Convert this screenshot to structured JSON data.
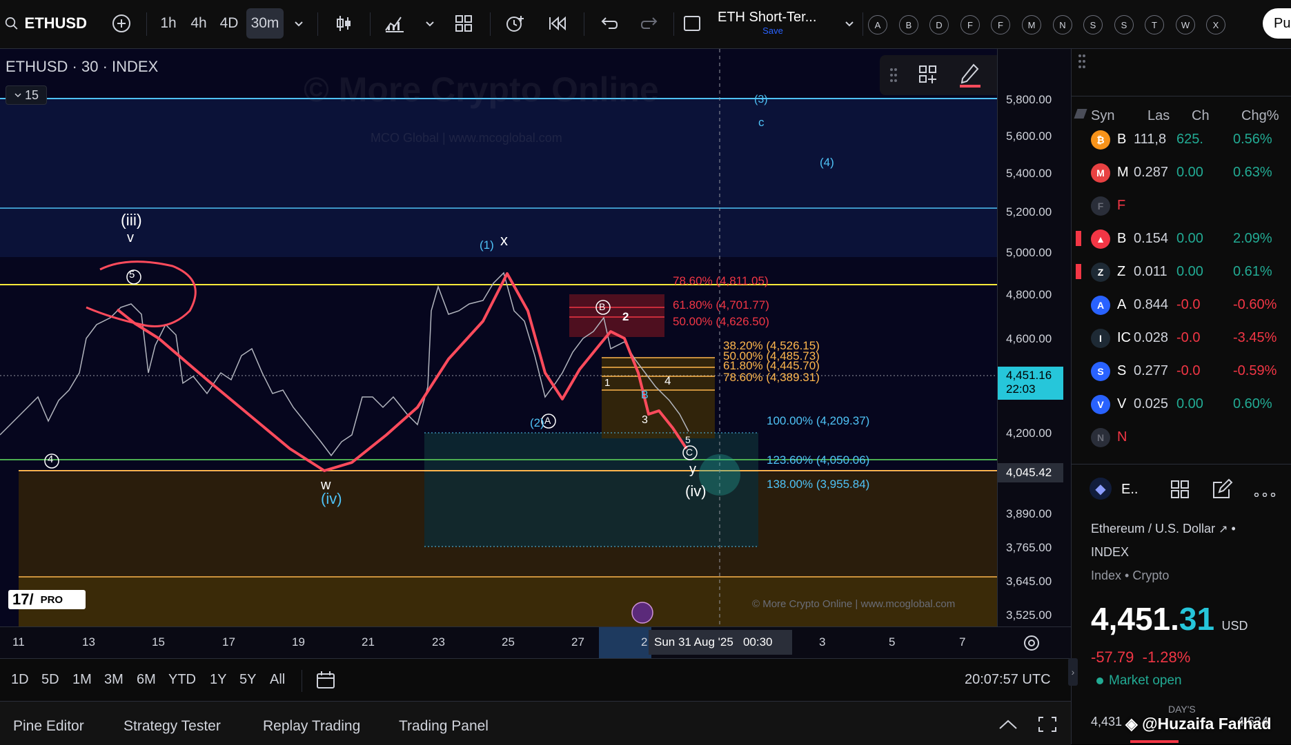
{
  "toolbar": {
    "symbol": "ETHUSD",
    "timeframes": [
      "1h",
      "4h",
      "4D",
      "30m"
    ],
    "layout_title": "ETH Short-Ter...",
    "layout_sub": "Save",
    "alert_letters": [
      "A",
      "B",
      "D",
      "F",
      "F",
      "M",
      "N",
      "S",
      "S",
      "T",
      "W",
      "X"
    ],
    "publish_partial": "Pu"
  },
  "chart": {
    "legend_title": "ETHUSD · 30 · INDEX",
    "indicator_count": "15",
    "watermark_main": "© More Crypto Online",
    "watermark_sub": "MCO Global  |  www.mcoglobal.com",
    "footer_watermark": "© More Crypto Online  |  www.mcoglobal.com",
    "logo_text": "PRO",
    "wave_labels": {
      "iii": "(iii)",
      "v_small": "v",
      "five": "5",
      "four_small": "4",
      "w": "w",
      "iv_left": "(iv)",
      "one": "(1)",
      "x": "x",
      "two": "(2)",
      "A": "A",
      "B_circ": "B",
      "two_num": "2",
      "one_num": "1",
      "four_num": "4",
      "B": "B",
      "three": "3",
      "five_small": "5",
      "C_circ": "C",
      "y": "y",
      "iv_right": "(iv)",
      "three_top": "(3)",
      "c_top": "c",
      "four_top": "(4)"
    },
    "fib_levels": [
      "78.60% (4,811.05)",
      "61.80% (4,701.77)",
      "50.00% (4,626.50)",
      "38.20% (4,526.15)",
      "50.00% (4,485.73)",
      "61.80% (4,445.70)",
      "78.60% (4,389.31)",
      "100.00% (4,209.37)",
      "123.60% (4,050.06)",
      "138.00% (3,955.84)"
    ],
    "stroke_width_label": "3px"
  },
  "price_axis": {
    "labels": [
      "5,800.00",
      "5,600.00",
      "5,400.00",
      "5,200.00",
      "5,000.00",
      "4,800.00",
      "4,600.00",
      "4,200.00",
      "3,890.00",
      "3,765.00",
      "3,645.00",
      "3,525.00"
    ],
    "current_price": "4,451.16",
    "countdown": "22:03",
    "crosshair_price": "4,045.42"
  },
  "time_axis": {
    "labels": [
      "11",
      "13",
      "15",
      "17",
      "19",
      "21",
      "23",
      "25",
      "27",
      "2",
      "3",
      "5",
      "7"
    ],
    "crosshair_time": "Sun 31 Aug '25   00:30"
  },
  "range_bar": {
    "ranges": [
      "1D",
      "5D",
      "1M",
      "3M",
      "6M",
      "YTD",
      "1Y",
      "5Y",
      "All"
    ],
    "clock": "20:07:57 UTC"
  },
  "bottom_panel": {
    "tabs": [
      "Pine Editor",
      "Strategy Tester",
      "Replay Trading",
      "Trading Panel"
    ]
  },
  "watchlist": {
    "headers": [
      "Syn",
      "Las",
      "Ch",
      "Chg%"
    ],
    "rows": [
      {
        "sym": "B",
        "last": "111,8",
        "ch": "625.",
        "chg": "0.56%",
        "color": "#f7931a",
        "glyph": "₿",
        "ch_dir": "pos",
        "chg_dir": "pos",
        "flag": false
      },
      {
        "sym": "M",
        "last": "0.287",
        "ch": "0.00",
        "chg": "0.63%",
        "color": "#e84142",
        "glyph": "M",
        "ch_dir": "pos",
        "chg_dir": "pos",
        "flag": false
      },
      {
        "sym": "F",
        "last": "",
        "ch": "",
        "chg": "",
        "color": "#2a2e39",
        "glyph": "F",
        "ch_dir": "neg",
        "chg_dir": "neg",
        "flag": false,
        "red_sym": true
      },
      {
        "sym": "B",
        "last": "0.154",
        "ch": "0.00",
        "chg": "2.09%",
        "color": "#f23645",
        "glyph": "▲",
        "ch_dir": "pos",
        "chg_dir": "pos",
        "flag": true
      },
      {
        "sym": "Z",
        "last": "0.011",
        "ch": "0.00",
        "chg": "0.61%",
        "color": "#1e2a35",
        "glyph": "Z",
        "ch_dir": "pos",
        "chg_dir": "pos",
        "flag": true
      },
      {
        "sym": "A",
        "last": "0.844",
        "ch": "-0.0",
        "chg": "-0.60%",
        "color": "#2962ff",
        "glyph": "A",
        "ch_dir": "neg",
        "chg_dir": "neg",
        "flag": false
      },
      {
        "sym": "IC",
        "last": "0.028",
        "ch": "-0.0",
        "chg": "-3.45%",
        "color": "#1e2a35",
        "glyph": "I",
        "ch_dir": "neg",
        "chg_dir": "neg",
        "flag": false
      },
      {
        "sym": "S",
        "last": "0.277",
        "ch": "-0.0",
        "chg": "-0.59%",
        "color": "#2962ff",
        "glyph": "S",
        "ch_dir": "neg",
        "chg_dir": "neg",
        "flag": false
      },
      {
        "sym": "V",
        "last": "0.025",
        "ch": "0.00",
        "chg": "0.60%",
        "color": "#2962ff",
        "glyph": "V",
        "ch_dir": "pos",
        "chg_dir": "pos",
        "flag": false
      },
      {
        "sym": "N",
        "last": "",
        "ch": "",
        "chg": "",
        "color": "#2a2e39",
        "glyph": "N",
        "ch_dir": "neg",
        "chg_dir": "neg",
        "flag": false,
        "red_sym": true
      }
    ],
    "detail": {
      "short": "E..",
      "name": "Ethereum / U.S. Dollar",
      "exchange": "INDEX",
      "category": "Index • Crypto",
      "price_main": "4,451.",
      "price_decimals": "31",
      "currency": "USD",
      "change": "-57.79",
      "change_pct": "-1.28%",
      "market_status": "Market open",
      "day_label": "DAY'S",
      "day_low": "4,431",
      "day_high": "4,634",
      "watermark_user": "@Huzaifa Farhad"
    }
  }
}
